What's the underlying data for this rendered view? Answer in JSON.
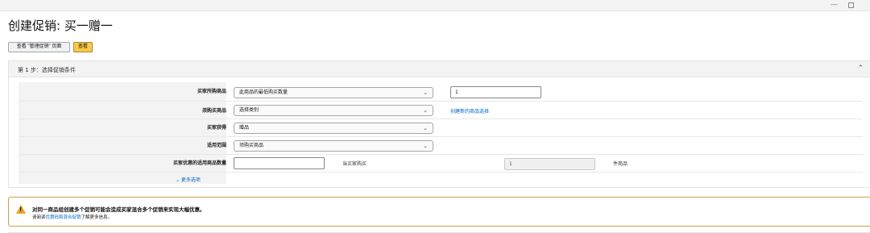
{
  "window": {
    "minimize": "—",
    "maximize": ""
  },
  "page": {
    "title": "创建促销: 买一赠一"
  },
  "buttons": {
    "view_manage": "查看 \"管理促销\" 页面",
    "view": "查看"
  },
  "section": {
    "title": "第 1 步：选择促销条件",
    "collapse_icon": "⌃"
  },
  "form": {
    "rows": [
      {
        "label": "买家所购商品",
        "select": "此商品的最低购买数量",
        "extra_input": "1"
      },
      {
        "label": "须购买商品",
        "select": "选择类别",
        "extra_link": "创建新的商品选择"
      },
      {
        "label": "买家获得",
        "select": "赠品"
      },
      {
        "label": "适用范围",
        "select": "须购买商品"
      },
      {
        "label": "买家优惠的适用商品数量",
        "input": "",
        "middle_text": "当买家购买",
        "readonly_input": "1",
        "suffix_text": "件商品"
      }
    ],
    "more_options": "⌄ 更多选项"
  },
  "alert": {
    "icon": "warning-icon",
    "title": "对同一商品组创建多个促销可能会造成买家混合多个促销来实现大幅优惠。",
    "body_prefix": "请阅读",
    "body_link": "优惠码和混合促销",
    "body_suffix": "了解更多信息。"
  },
  "colors": {
    "accent_button": "#f7ca4a",
    "link": "#0066c0",
    "alert_border": "#c7a24a",
    "warning": "#e8a317"
  }
}
